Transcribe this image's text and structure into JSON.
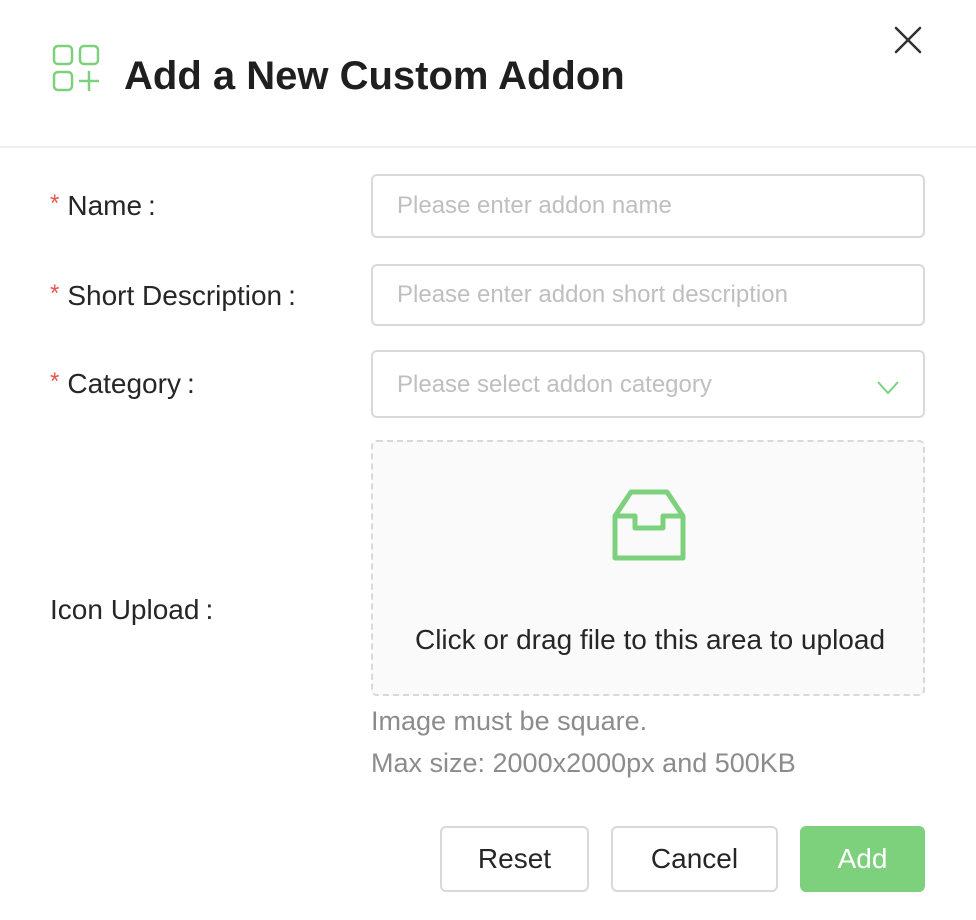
{
  "dialog": {
    "title": "Add a New Custom Addon",
    "header_icon": "app-add-icon",
    "close_icon": "close-icon"
  },
  "form": {
    "name": {
      "required_mark": "*",
      "label": "Name",
      "colon": ":",
      "value": "",
      "placeholder": "Please enter addon name"
    },
    "short_description": {
      "required_mark": "*",
      "label": "Short Description",
      "colon": ":",
      "value": "",
      "placeholder": "Please enter addon short description"
    },
    "category": {
      "required_mark": "*",
      "label": "Category",
      "colon": ":",
      "selected": "",
      "placeholder": "Please select addon category",
      "arrow_icon": "chevron-down-icon"
    },
    "icon_upload": {
      "label": "Icon Upload",
      "colon": ":",
      "dropzone_icon": "inbox-icon",
      "dropzone_text": "Click or drag file to this area to upload",
      "hint_line1": "Image must be square.",
      "hint_line2": "Max size: 2000x2000px and 500KB"
    }
  },
  "footer": {
    "reset_label": "Reset",
    "cancel_label": "Cancel",
    "add_label": "Add"
  },
  "colors": {
    "accent": "#7dd17c",
    "required": "#e8564a",
    "border": "#d9d9d9",
    "placeholder": "#bfbfbf",
    "hint": "#8c8c8c"
  }
}
